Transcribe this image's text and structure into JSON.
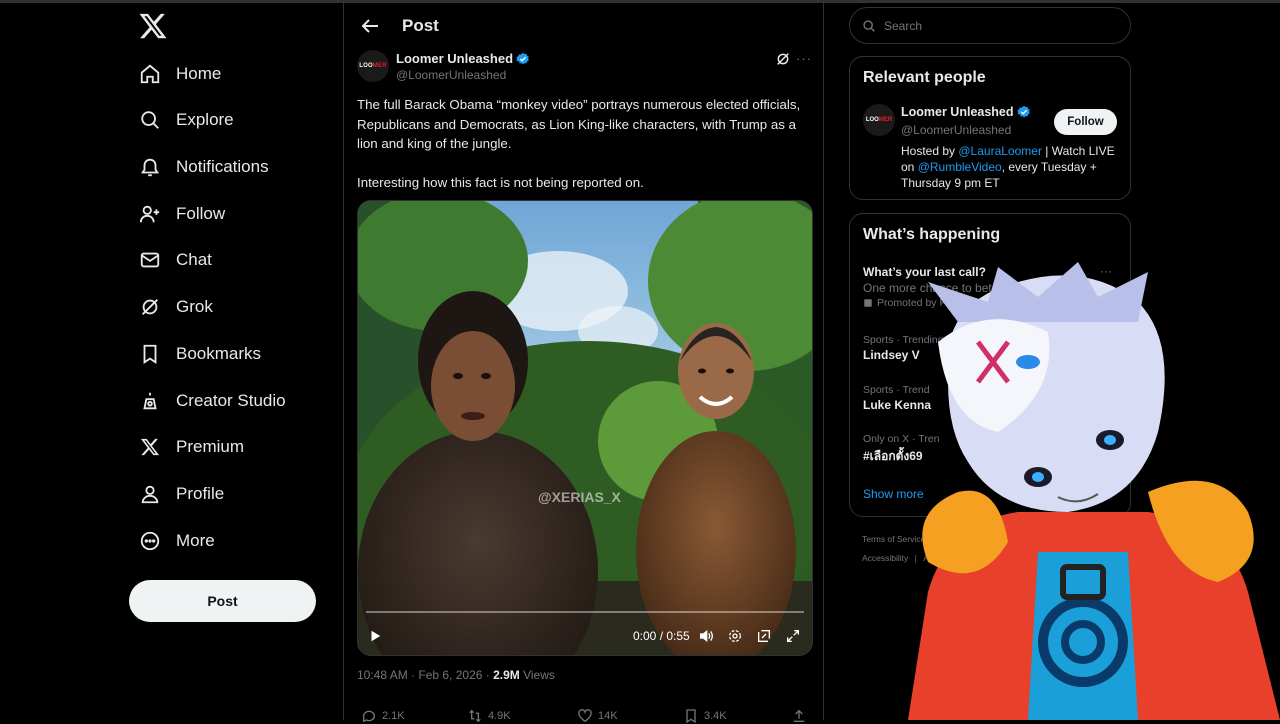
{
  "nav": {
    "items": [
      {
        "label": "Home",
        "icon": "home-icon"
      },
      {
        "label": "Explore",
        "icon": "search-icon"
      },
      {
        "label": "Notifications",
        "icon": "bell-icon"
      },
      {
        "label": "Follow",
        "icon": "add-person-icon"
      },
      {
        "label": "Chat",
        "icon": "mail-icon"
      },
      {
        "label": "Grok",
        "icon": "grok-icon"
      },
      {
        "label": "Bookmarks",
        "icon": "bookmark-icon"
      },
      {
        "label": "Creator Studio",
        "icon": "creator-icon"
      },
      {
        "label": "Premium",
        "icon": "x-logo-icon"
      },
      {
        "label": "Profile",
        "icon": "person-icon"
      },
      {
        "label": "More",
        "icon": "more-circle-icon"
      }
    ],
    "post_label": "Post"
  },
  "header": {
    "title": "Post"
  },
  "tweet": {
    "author_name": "Loomer Unleashed",
    "author_handle": "@LoomerUnleashed",
    "avatar_text_a": "LOO",
    "avatar_text_b": "MER",
    "text_1": "The full Barack Obama “monkey video” portrays numerous elected officials, Republicans and Democrats, as Lion King-like characters, with Trump as a lion and king of the jungle.",
    "text_2": "Interesting how this fact is not being reported on.",
    "watermark": "@XERIAS_X",
    "video_time": "0:00 / 0:55",
    "progress": 0,
    "timestamp": "10:48 AM · Feb 6, 2026 · ",
    "views_count": "2.9M",
    "views_label": " Views",
    "actions": {
      "replies": "2.1K",
      "reposts": "4.9K",
      "likes": "14K",
      "bookmarks": "3.4K"
    }
  },
  "search": {
    "placeholder": "Search"
  },
  "relevant": {
    "title": "Relevant people",
    "name": "Loomer Unleashed",
    "handle": "@LoomerUnleashed",
    "follow_label": "Follow",
    "bio_1": "Hosted by ",
    "bio_link_1": "@LauraLoomer",
    "bio_2": " | Watch LIVE on ",
    "bio_link_2": "@RumbleVideo",
    "bio_3": ", every Tuesday + Thursday 9 pm ET"
  },
  "happening": {
    "title": "What’s happening",
    "trends": [
      {
        "title": "What’s your last call?",
        "sub": "One more chance to bet footb",
        "promo": "Promoted by FanDuel Sp"
      },
      {
        "ctx": "Sports · Trending",
        "title": "Lindsey V"
      },
      {
        "ctx": "Sports · Trend",
        "title": "Luke Kenna"
      },
      {
        "ctx": "Only on X · Tren",
        "title": "#เลือกตั้ง69"
      }
    ],
    "show_more": "Show more"
  },
  "footer": {
    "line1": [
      "Terms of Service",
      "|"
    ],
    "line2": [
      "Accessibility",
      "|",
      "Ads"
    ]
  },
  "colors": {
    "accent": "#1d9bf0",
    "bg": "#000000",
    "text": "#e7e9ea",
    "muted": "#71767b"
  }
}
